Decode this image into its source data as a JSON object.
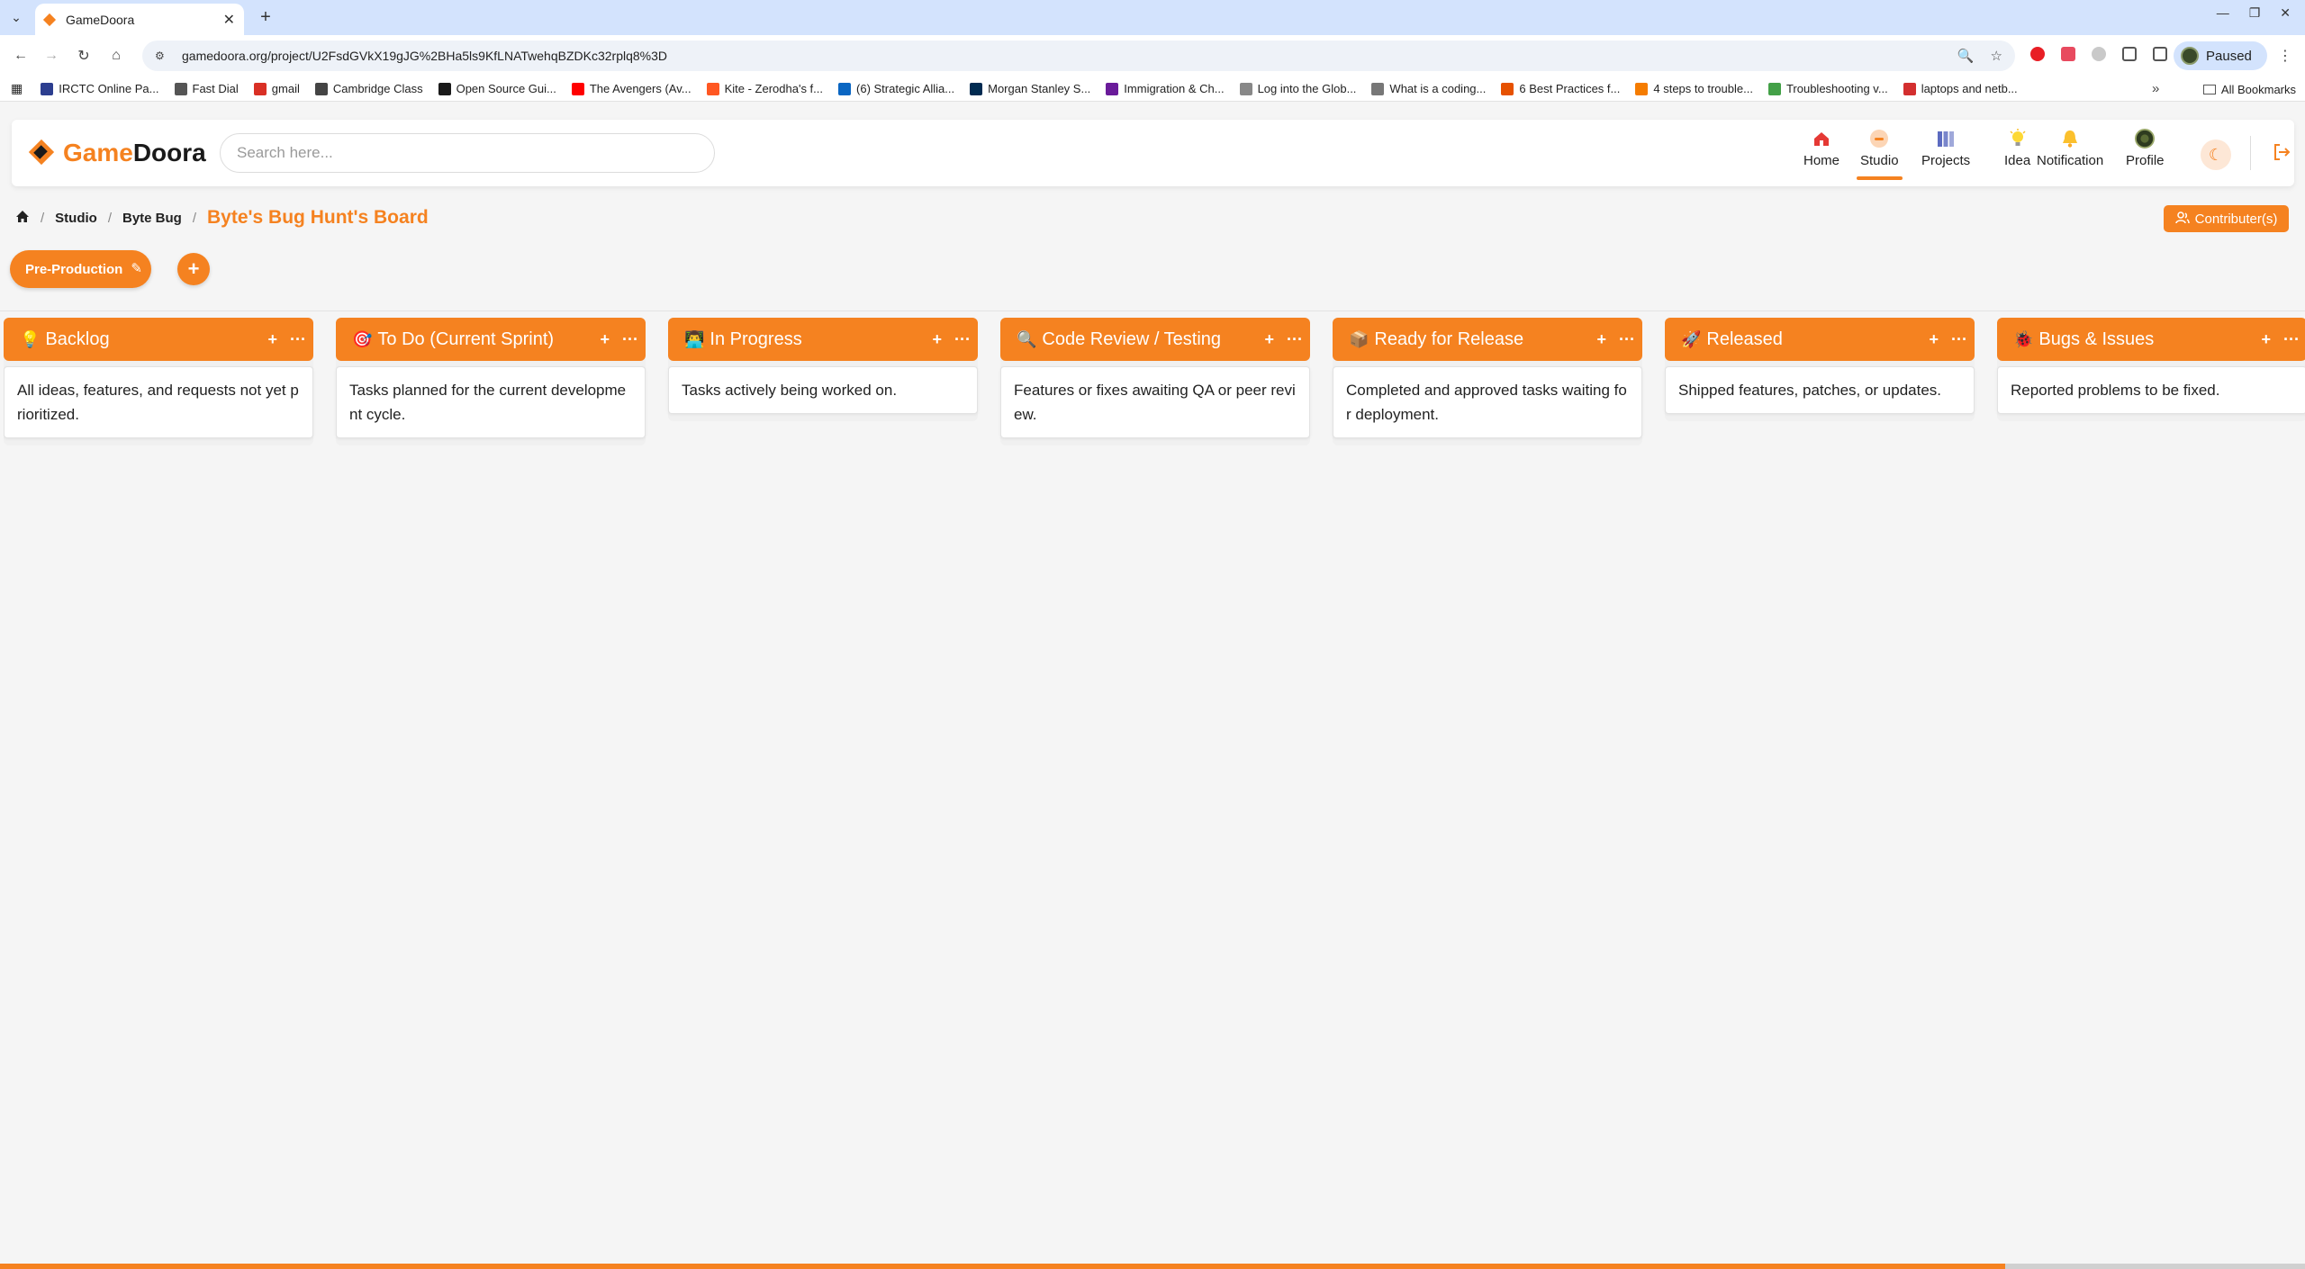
{
  "browser": {
    "tab_title": "GameDoora",
    "url": "gamedoora.org/project/U2FsdGVkX19gJG%2BHa5ls9KfLNATwehqBZDKc32rplq8%3D",
    "profile_label": "Paused",
    "bookmarks": [
      {
        "label": "IRCTC Online Pa...",
        "icon": "irctc-icon",
        "color": "#2c3e8f"
      },
      {
        "label": "Fast Dial",
        "icon": "folder-icon",
        "color": "#555555"
      },
      {
        "label": "gmail",
        "icon": "gmail-icon",
        "color": "#d93025"
      },
      {
        "label": "Cambridge Class",
        "icon": "cambridge-icon",
        "color": "#444444"
      },
      {
        "label": "Open Source Gui...",
        "icon": "github-icon",
        "color": "#1a1a1a"
      },
      {
        "label": "The Avengers (Av...",
        "icon": "youtube-icon",
        "color": "#ff0000"
      },
      {
        "label": "Kite - Zerodha's f...",
        "icon": "kite-icon",
        "color": "#ff5722"
      },
      {
        "label": "(6) Strategic Allia...",
        "icon": "linkedin-icon",
        "color": "#0a66c2"
      },
      {
        "label": "Morgan Stanley S...",
        "icon": "ms-icon",
        "color": "#002b51"
      },
      {
        "label": "Immigration & Ch...",
        "icon": "immigration-icon",
        "color": "#6a1b9a"
      },
      {
        "label": "Log into the Glob...",
        "icon": "globe-icon",
        "color": "#888888"
      },
      {
        "label": "What is a coding...",
        "icon": "coding-icon",
        "color": "#777777"
      },
      {
        "label": "6 Best Practices f...",
        "icon": "practices-icon",
        "color": "#e65100"
      },
      {
        "label": "4 steps to trouble...",
        "icon": "steps-icon",
        "color": "#f57c00"
      },
      {
        "label": "Troubleshooting v...",
        "icon": "troubleshoot-icon",
        "color": "#43a047"
      },
      {
        "label": "laptops and netb...",
        "icon": "laptop-icon",
        "color": "#d32f2f"
      }
    ],
    "all_bookmarks_label": "All Bookmarks"
  },
  "header": {
    "brand_game": "Game",
    "brand_doora": "Doora",
    "search_placeholder": "Search here...",
    "nav": [
      {
        "label": "Home",
        "icon": "home-icon",
        "active": false
      },
      {
        "label": "Studio",
        "icon": "studio-icon",
        "active": true
      },
      {
        "label": "Projects",
        "icon": "projects-icon",
        "active": false
      },
      {
        "label": "Idea",
        "icon": "idea-icon",
        "active": false
      },
      {
        "label": "Notification",
        "icon": "notification-icon",
        "active": false
      },
      {
        "label": "Profile",
        "icon": "profile-avatar-icon",
        "active": false
      }
    ]
  },
  "breadcrumb": {
    "items": [
      "Studio",
      "Byte Bug"
    ],
    "current": "Byte's Bug Hunt's Board"
  },
  "contributors_label": "Contributer(s)",
  "stage": {
    "label": "Pre-Production"
  },
  "columns": [
    {
      "emoji": "💡",
      "title": "Backlog",
      "description": "All ideas, features, and requests not yet prioritized."
    },
    {
      "emoji": "🎯",
      "title": "To Do (Current Sprint)",
      "description": "Tasks planned for the current development cycle."
    },
    {
      "emoji": "👨‍💻",
      "title": "In Progress",
      "description": "Tasks actively being worked on."
    },
    {
      "emoji": "🔍",
      "title": "Code Review / Testing",
      "description": "Features or fixes awaiting QA or peer review."
    },
    {
      "emoji": "📦",
      "title": "Ready for Release",
      "description": "Completed and approved tasks waiting for deployment."
    },
    {
      "emoji": "🚀",
      "title": "Released",
      "description": "Shipped features, patches, or updates."
    },
    {
      "emoji": "🐞",
      "title": "Bugs & Issues",
      "description": "Reported problems to be fixed."
    }
  ],
  "colors": {
    "accent": "#f58220",
    "background": "#f5f5f5"
  },
  "page_progress": 0.87
}
